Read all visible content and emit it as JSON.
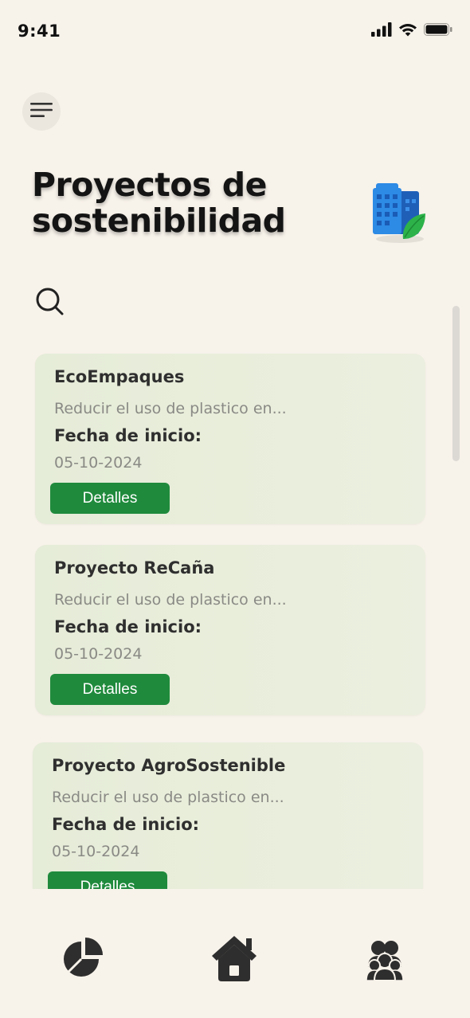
{
  "status_bar": {
    "time": "9:41",
    "icons": [
      "cellular-signal-icon",
      "wifi-icon",
      "battery-icon"
    ]
  },
  "header": {
    "menu_icon": "menu-icon",
    "title_line1": "Proyectos de",
    "title_line2": "sostenibilidad",
    "illustration_icon": "green-building-icon"
  },
  "search": {
    "icon": "search-icon"
  },
  "projects": [
    {
      "name": "EcoEmpaques",
      "description": "Reducir el uso de plastico en...",
      "date_label": "Fecha de inicio:",
      "date": "05-10-2024",
      "button_label": "Detalles"
    },
    {
      "name": "Proyecto ReCaña",
      "description": "Reducir el uso de plastico en...",
      "date_label": "Fecha de inicio:",
      "date": "05-10-2024",
      "button_label": "Detalles"
    },
    {
      "name": "Proyecto AgroSostenible",
      "description": "Reducir el uso de plastico en...",
      "date_label": "Fecha de inicio:",
      "date": "05-10-2024",
      "button_label": "Detalles"
    }
  ],
  "bottom_nav": {
    "items": [
      "pie-chart-icon",
      "home-icon",
      "users-icon"
    ]
  },
  "colors": {
    "background": "#f7f2ea",
    "card": "#e7edda",
    "accent_button": "#1f8a3c",
    "text_dark": "#2f2f2f",
    "text_muted": "#8a8a85"
  }
}
